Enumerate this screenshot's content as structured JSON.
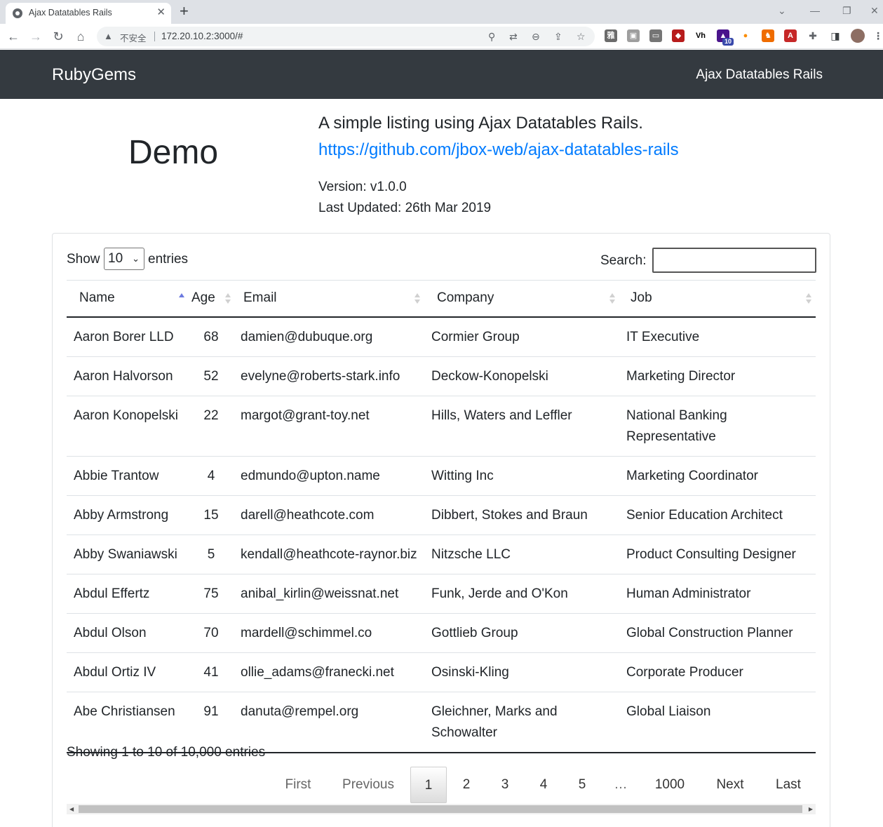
{
  "browser": {
    "tab_title": "Ajax Datatables Rails",
    "close_glyph": "✕",
    "new_tab_glyph": "+",
    "insecure_label": "不安全",
    "url": "172.20.10.2:3000/#",
    "badge_count": "10"
  },
  "navbar": {
    "brand": "RubyGems",
    "right_link": "Ajax Datatables Rails"
  },
  "header": {
    "title": "Demo",
    "lead": "A simple listing using Ajax Datatables Rails.",
    "link": "https://github.com/jbox-web/ajax-datatables-rails",
    "version": "Version: v1.0.0",
    "last_updated": "Last Updated: 26th Mar 2019"
  },
  "table_controls": {
    "show_label": "Show",
    "length_value": "10",
    "entries_label": "entries",
    "search_label": "Search:",
    "search_value": ""
  },
  "table": {
    "columns": [
      "Name",
      "Age",
      "Email",
      "Company",
      "Job"
    ],
    "rows": [
      {
        "name": "Aaron Borer LLD",
        "age": "68",
        "email": "damien@dubuque.org",
        "company": "Cormier Group",
        "job": "IT Executive"
      },
      {
        "name": "Aaron Halvorson",
        "age": "52",
        "email": "evelyne@roberts-stark.info",
        "company": "Deckow-Konopelski",
        "job": "Marketing Director"
      },
      {
        "name": "Aaron Konopelski",
        "age": "22",
        "email": "margot@grant-toy.net",
        "company": "Hills, Waters and Leffler",
        "job": "National Banking Representative"
      },
      {
        "name": "Abbie Trantow",
        "age": "4",
        "email": "edmundo@upton.name",
        "company": "Witting Inc",
        "job": "Marketing Coordinator"
      },
      {
        "name": "Abby Armstrong",
        "age": "15",
        "email": "darell@heathcote.com",
        "company": "Dibbert, Stokes and Braun",
        "job": "Senior Education Architect"
      },
      {
        "name": "Abby Swaniawski",
        "age": "5",
        "email": "kendall@heathcote-raynor.biz",
        "company": "Nitzsche LLC",
        "job": "Product Consulting Designer"
      },
      {
        "name": "Abdul Effertz",
        "age": "75",
        "email": "anibal_kirlin@weissnat.net",
        "company": "Funk, Jerde and O'Kon",
        "job": "Human Administrator"
      },
      {
        "name": "Abdul Olson",
        "age": "70",
        "email": "mardell@schimmel.co",
        "company": "Gottlieb Group",
        "job": "Global Construction Planner"
      },
      {
        "name": "Abdul Ortiz IV",
        "age": "41",
        "email": "ollie_adams@franecki.net",
        "company": "Osinski-Kling",
        "job": "Corporate Producer"
      },
      {
        "name": "Abe Christiansen",
        "age": "91",
        "email": "danuta@rempel.org",
        "company": "Gleichner, Marks and Schowalter",
        "job": "Global Liaison"
      }
    ]
  },
  "footer": {
    "info": "Showing 1 to 10 of 10,000 entries",
    "pagination": {
      "first": "First",
      "previous": "Previous",
      "pages": [
        "1",
        "2",
        "3",
        "4",
        "5"
      ],
      "ellipsis": "…",
      "last_page": "1000",
      "next": "Next",
      "last": "Last"
    }
  },
  "icons": {
    "back": "arrow-left-icon",
    "forward": "arrow-right-icon",
    "reload": "reload-icon",
    "home": "home-icon",
    "sort_ascending": "sort-up-icon",
    "sortable": "sort-both-icon"
  },
  "colors": {
    "navbar_bg": "#343a40",
    "link": "#007bff",
    "sort_active": "#6c7ae0"
  }
}
